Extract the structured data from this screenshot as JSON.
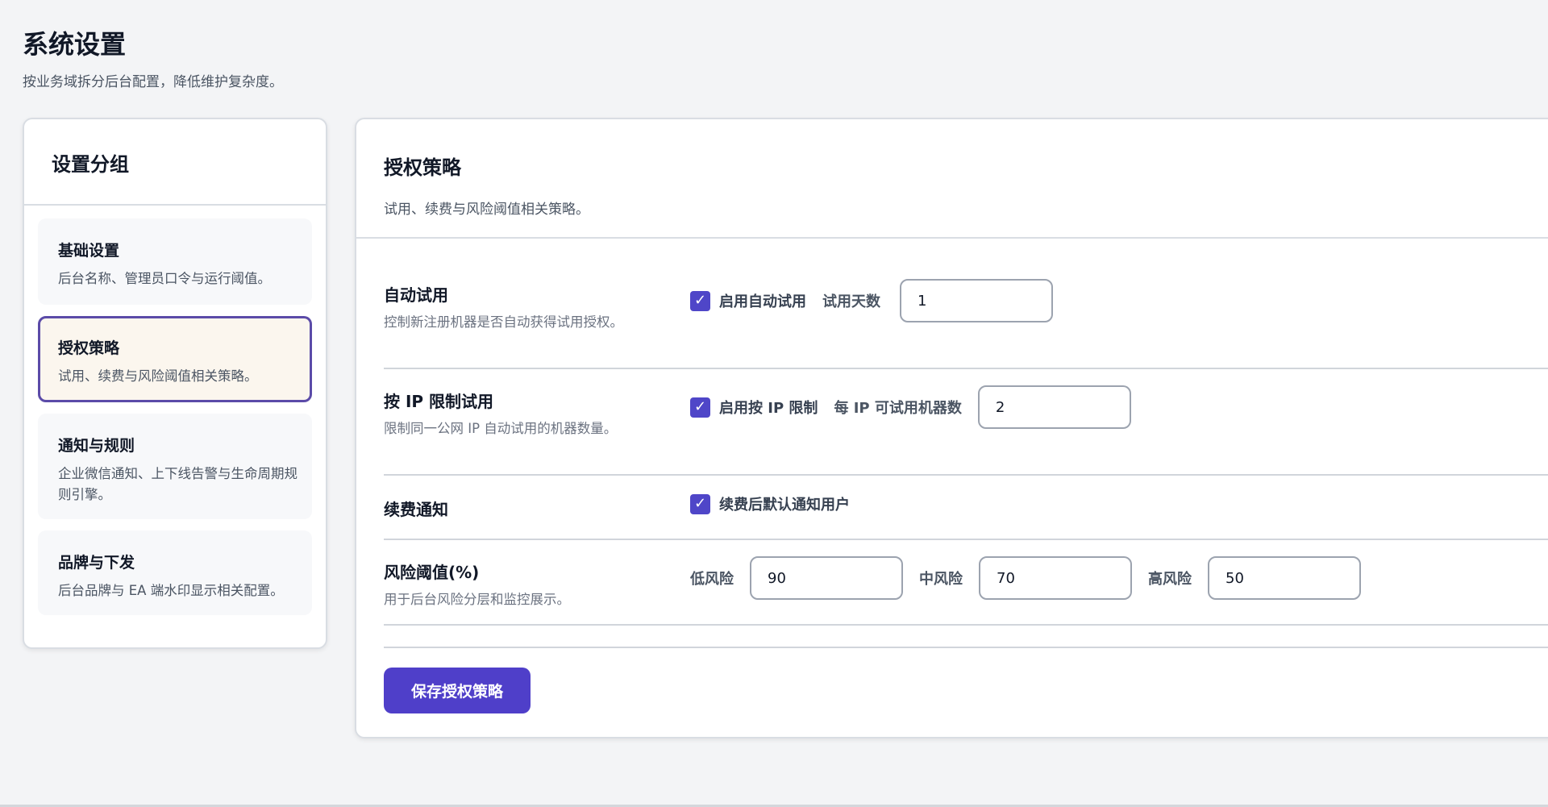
{
  "page": {
    "title": "系统设置",
    "subtitle": "按业务域拆分后台配置，降低维护复杂度。"
  },
  "sidebar": {
    "title": "设置分组",
    "items": [
      {
        "title": "基础设置",
        "desc": "后台名称、管理员口令与运行阈值。",
        "active": false
      },
      {
        "title": "授权策略",
        "desc": "试用、续费与风险阈值相关策略。",
        "active": true
      },
      {
        "title": "通知与规则",
        "desc": "企业微信通知、上下线告警与生命周期规则引擎。",
        "active": false
      },
      {
        "title": "品牌与下发",
        "desc": "后台品牌与 EA 端水印显示相关配置。",
        "active": false
      }
    ]
  },
  "main": {
    "title": "授权策略",
    "subtitle": "试用、续费与风险阈值相关策略。",
    "auto_trial": {
      "title": "自动试用",
      "desc": "控制新注册机器是否自动获得试用授权。",
      "checkbox_label": "启用自动试用",
      "checked": true,
      "days_label": "试用天数",
      "days_value": "1"
    },
    "ip_limit": {
      "title": "按 IP 限制试用",
      "desc": "限制同一公网 IP 自动试用的机器数量。",
      "checkbox_label": "启用按 IP 限制",
      "checked": true,
      "count_label": "每 IP 可试用机器数",
      "count_value": "2"
    },
    "renew_notice": {
      "title": "续费通知",
      "checkbox_label": "续费后默认通知用户",
      "checked": true
    },
    "risk": {
      "title": "风险阈值(%)",
      "desc": "用于后台风险分层和监控展示。",
      "low_label": "低风险",
      "low_value": "90",
      "mid_label": "中风险",
      "mid_value": "70",
      "high_label": "高风险",
      "high_value": "50"
    },
    "save_label": "保存授权策略"
  },
  "colors": {
    "accent": "#4f3fc9",
    "checkbox": "#4f46c8",
    "active_border": "#5b4ba8",
    "active_bg": "#fbf6ee"
  }
}
